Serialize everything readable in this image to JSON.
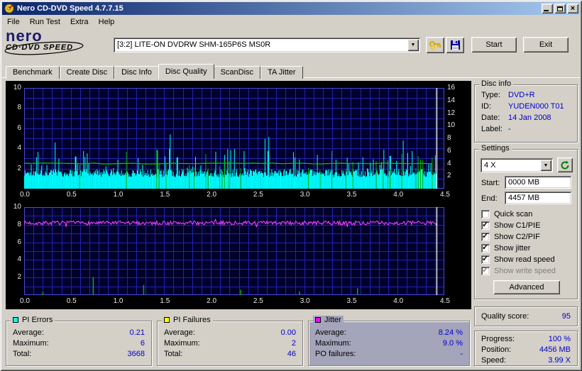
{
  "window": {
    "title": "Nero CD-DVD Speed 4.7.7.15"
  },
  "menu": {
    "items": [
      "File",
      "Run Test",
      "Extra",
      "Help"
    ]
  },
  "logo": {
    "brand": "nero",
    "product": "CD·DVD SPEED"
  },
  "toolbar": {
    "drive": "[3:2]   LITE-ON DVDRW SHM-165P6S MS0R",
    "options_icon": "keys-icon",
    "save_icon": "floppy-disk-icon",
    "start": "Start",
    "exit": "Exit"
  },
  "tabs": {
    "labels": [
      "Benchmark",
      "Create Disc",
      "Disc Info",
      "Disc Quality",
      "ScanDisc",
      "TA Jitter"
    ],
    "active": "Disc Quality"
  },
  "disc_info": {
    "title": "Disc info",
    "rows": [
      [
        "Type:",
        "DVD+R"
      ],
      [
        "ID:",
        "YUDEN000 T01"
      ],
      [
        "Date:",
        "14 Jan 2008"
      ],
      [
        "Label:",
        "-"
      ]
    ]
  },
  "settings": {
    "title": "Settings",
    "speed": "4 X",
    "refresh_icon": "refresh-disc-icon",
    "start_label": "Start:",
    "start_value": "0000 MB",
    "end_label": "End:",
    "end_value": "4457 MB",
    "checkboxes": [
      {
        "label": "Quick scan",
        "checked": false,
        "disabled": false
      },
      {
        "label": "Show C1/PIE",
        "checked": true,
        "disabled": false
      },
      {
        "label": "Show C2/PIF",
        "checked": true,
        "disabled": false
      },
      {
        "label": "Show jitter",
        "checked": true,
        "disabled": false
      },
      {
        "label": "Show read speed",
        "checked": true,
        "disabled": false
      },
      {
        "label": "Show write speed",
        "checked": true,
        "disabled": true
      }
    ],
    "advanced": "Advanced"
  },
  "quality": {
    "label": "Quality score:",
    "value": "95"
  },
  "status": {
    "rows": [
      [
        "Progress:",
        "100 %"
      ],
      [
        "Position:",
        "4456 MB"
      ],
      [
        "Speed:",
        "3.99 X"
      ]
    ]
  },
  "legend_panels": [
    {
      "title": "PI Errors",
      "color": "#00FFFF",
      "rows": [
        [
          "Average:",
          "0.21"
        ],
        [
          "Maximum:",
          "6"
        ],
        [
          "Total:",
          "3668"
        ]
      ]
    },
    {
      "title": "PI Failures",
      "color": "#FFFF00",
      "rows": [
        [
          "Average:",
          "0.00"
        ],
        [
          "Maximum:",
          "2"
        ],
        [
          "Total:",
          "46"
        ]
      ]
    },
    {
      "title": "Jitter",
      "color": "#FF00FF",
      "rows": [
        [
          "Average:",
          "8.24 %"
        ],
        [
          "Maximum:",
          "9.0 %"
        ],
        [
          "PO failures:",
          "-"
        ]
      ]
    }
  ],
  "chart_data": [
    {
      "type": "area",
      "name": "PI Errors / read speed",
      "xlim": [
        0,
        4.5
      ],
      "ylim_left": [
        0,
        10
      ],
      "ylim_right": [
        0,
        16
      ],
      "x_ticks": [
        "0.0",
        "0.5",
        "1.0",
        "1.5",
        "2.0",
        "2.5",
        "3.0",
        "3.5",
        "4.0",
        "4.5"
      ],
      "y_ticks_left": [
        "2",
        "4",
        "6",
        "8",
        "10"
      ],
      "y_ticks_right": [
        "2",
        "4",
        "6",
        "8",
        "10",
        "12",
        "14",
        "16"
      ],
      "pi_errors": {
        "color": "#00ffff",
        "average": 0.21,
        "maximum": 6,
        "total": 3668,
        "base_level": 1.6,
        "spike_max": 5.5
      },
      "green_spikes_color": "#00b400",
      "read_speed": {
        "color": "#00d000",
        "speed_x": 4.0,
        "final_x": 3.99,
        "level_left_units": 2.5
      },
      "scan_end_x": 4.42,
      "end_marker_color": "#ffffff",
      "grid": true,
      "seed": 1337
    },
    {
      "type": "line",
      "name": "Jitter / PI failures",
      "xlim": [
        0,
        4.5
      ],
      "ylim_left": [
        0,
        10
      ],
      "x_ticks": [
        "0.0",
        "0.5",
        "1.0",
        "1.5",
        "2.0",
        "2.5",
        "3.0",
        "3.5",
        "4.0",
        "4.5"
      ],
      "y_ticks_left": [
        "2",
        "4",
        "6",
        "8",
        "10"
      ],
      "jitter": {
        "color": "#ff46ff",
        "average": 8.24,
        "maximum": 9.0,
        "base_level": 8.2
      },
      "pi_failure_spikes": [
        [
          0.2,
          0.35
        ],
        [
          0.74,
          2.05
        ],
        [
          1.28,
          1.15
        ],
        [
          2.32,
          0.6
        ],
        [
          2.95,
          0.4
        ],
        [
          3.57,
          0.8
        ]
      ],
      "spike_color": "#00b400",
      "scan_end_x": 4.42,
      "end_marker_color": "#ffffff",
      "grid": true,
      "seed": 7
    }
  ]
}
